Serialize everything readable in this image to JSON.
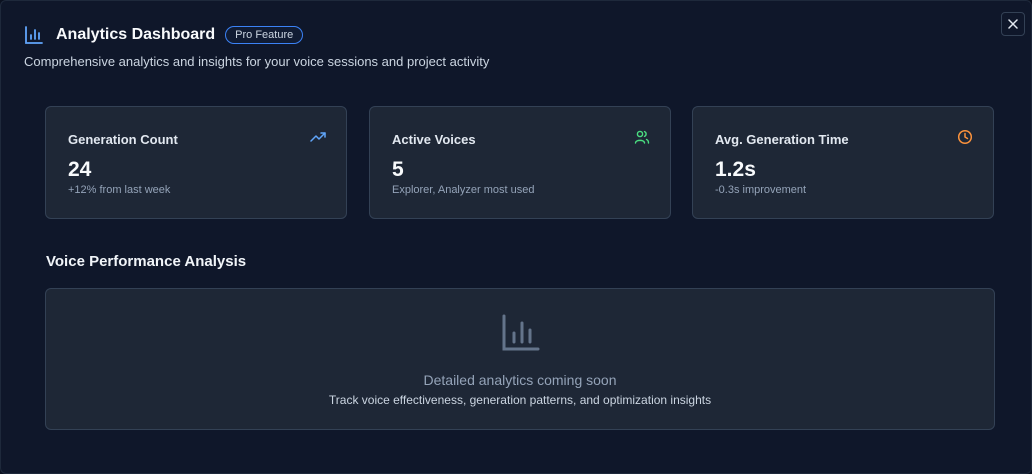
{
  "header": {
    "title": "Analytics Dashboard",
    "badge": "Pro Feature",
    "subtitle": "Comprehensive analytics and insights for your voice sessions and project activity",
    "icon": "bar-chart-icon",
    "accent": "#3b82f6"
  },
  "close": {
    "icon": "close-icon"
  },
  "cards": [
    {
      "label": "Generation Count",
      "value": "24",
      "note": "+12% from last week",
      "icon": "trending-up-icon",
      "icon_color": "#60a5fa"
    },
    {
      "label": "Active Voices",
      "value": "5",
      "note": "Explorer, Analyzer most used",
      "icon": "users-icon",
      "icon_color": "#4ade80"
    },
    {
      "label": "Avg. Generation Time",
      "value": "1.2s",
      "note": "-0.3s improvement",
      "icon": "clock-icon",
      "icon_color": "#fb923c"
    }
  ],
  "section": {
    "title": "Voice Performance Analysis"
  },
  "placeholder": {
    "icon": "bar-chart-icon",
    "title": "Detailed analytics coming soon",
    "subtitle": "Track voice effectiveness, generation patterns, and optimization insights"
  }
}
